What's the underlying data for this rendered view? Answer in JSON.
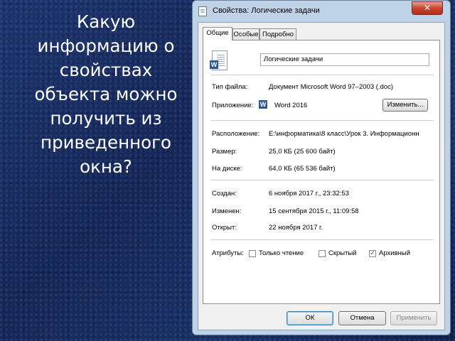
{
  "slide": {
    "question": "Какую информацию о свойствах объекта можно получить из приведенного окна?"
  },
  "dialog": {
    "title": "Свойства: Логические задачи",
    "close_label": "✕",
    "tabs": [
      {
        "label": "Общие",
        "active": true
      },
      {
        "label": "Особые",
        "active": false
      },
      {
        "label": "Подробно",
        "active": false
      }
    ],
    "file_name": "Логические задачи",
    "fields": {
      "type_label": "Тип файла:",
      "type_value": "Документ Microsoft Word 97–2003 (.doc)",
      "app_label": "Приложение:",
      "app_value": "Word 2016",
      "change_button": "Изменить...",
      "location_label": "Расположение:",
      "location_value": "E:\\информатика\\8 класс\\Урок 3. Информационн",
      "size_label": "Размер:",
      "size_value": "25,0 КБ (25 600 байт)",
      "disk_label": "На диске:",
      "disk_value": "64,0 КБ (65 536 байт)",
      "created_label": "Создан:",
      "created_value": "6 ноября 2017 г., 23:32:53",
      "modified_label": "Изменен:",
      "modified_value": "15 сентября 2015 г., 11:09:58",
      "opened_label": "Открыт:",
      "opened_value": "22 ноября 2017 г."
    },
    "attributes": {
      "label": "Атрибуты:",
      "readonly_label": "Только чтение",
      "readonly_checked": false,
      "hidden_label": "Скрытый",
      "hidden_checked": false,
      "archive_label": "Архивный",
      "archive_checked": true
    },
    "buttons": {
      "ok": "ОК",
      "cancel": "Отмена",
      "apply": "Применить"
    },
    "colors": {
      "slide_bg": "#1a3268",
      "close_button": "#c7442f",
      "window_frame": "#bfd3e8"
    }
  }
}
